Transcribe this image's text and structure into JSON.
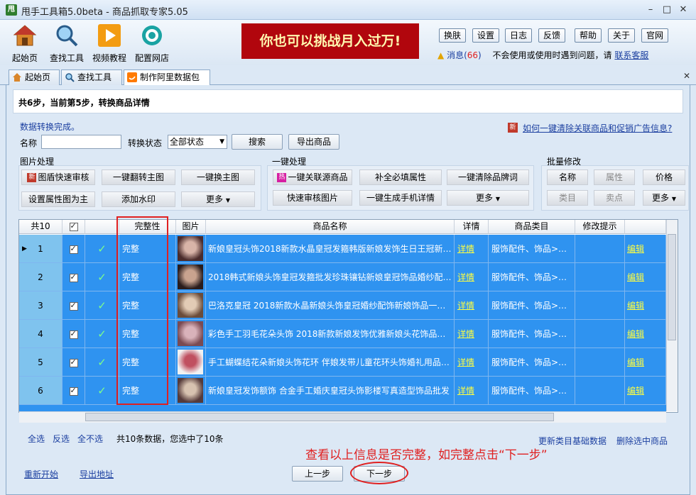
{
  "window": {
    "title": "甩手工具箱5.0beta - 商品抓取专家5.05",
    "icon_text": "甩"
  },
  "toolbar": {
    "items": [
      {
        "label": "起始页",
        "icon": "home-icon"
      },
      {
        "label": "查找工具",
        "icon": "magnifier-icon"
      },
      {
        "label": "视频教程",
        "icon": "play-icon"
      },
      {
        "label": "配置网店",
        "icon": "gear-icon"
      }
    ],
    "banner": "你也可以挑战月入过万!",
    "buttons": [
      "换肤",
      "设置",
      "日志",
      "反馈",
      "帮助",
      "关于",
      "官网"
    ],
    "message_label": "消息(",
    "message_count": "66",
    "message_close": ")",
    "help_text": "不会使用或使用时遇到问题，请",
    "help_link": "联系客服"
  },
  "tabs": [
    {
      "label": "起始页",
      "icon": "home-icon"
    },
    {
      "label": "查找工具",
      "icon": "magnifier-icon"
    },
    {
      "label": "制作阿里数据包",
      "icon": "alibaba-icon",
      "active": true
    }
  ],
  "step": {
    "text": "共6步，当前第5步，转换商品详情"
  },
  "status": "数据转换完成。",
  "help_link": "如何一键清除关联商品和促销广告信息?",
  "filter": {
    "name_label": "名称",
    "name_value": "",
    "state_label": "转换状态",
    "state_value": "全部状态",
    "search_label": "搜索",
    "export_label": "导出商品"
  },
  "image_group": {
    "title": "图片处理",
    "buttons": [
      "图盾快速审核",
      "一键翻转主图",
      "一键换主图",
      "设置属性图为主",
      "添加水印",
      "更多"
    ],
    "badge": "新"
  },
  "onekey_group": {
    "title": "一键处理",
    "buttons": [
      "一键关联源商品",
      "补全必填属性",
      "一键清除品牌词",
      "快速审核图片",
      "一键生成手机详情",
      "更多"
    ],
    "badge": "热"
  },
  "batch_group": {
    "title": "批量修改",
    "buttons": [
      "名称",
      "属性",
      "价格",
      "类目",
      "卖点",
      "更多"
    ]
  },
  "grid": {
    "headers": [
      "共10",
      "",
      "",
      "完整性",
      "图片",
      "商品名称",
      "详情",
      "商品类目",
      "修改提示",
      ""
    ],
    "rows": [
      {
        "num": "1",
        "complete": "完整",
        "name": "新娘皇冠头饰2018新款水晶皇冠发箍韩版新娘发饰生日王冠新…",
        "detail": "详情",
        "category": "服饰配件、饰品>…",
        "edit": "编辑"
      },
      {
        "num": "2",
        "complete": "完整",
        "name": "2018韩式新娘头饰皇冠发箍批发珍珠镶钻新娘皇冠饰品婚纱配…",
        "detail": "详情",
        "category": "服饰配件、饰品>…",
        "edit": "编辑"
      },
      {
        "num": "3",
        "complete": "完整",
        "name": "巴洛克皇冠 2018新款水晶新娘头饰皇冠婚纱配饰新娘饰品一…",
        "detail": "详情",
        "category": "服饰配件、饰品>…",
        "edit": "编辑"
      },
      {
        "num": "4",
        "complete": "完整",
        "name": "彩色手工羽毛花朵头饰 2018新款新娘发饰优雅新娘头花饰品…",
        "detail": "详情",
        "category": "服饰配件、饰品>…",
        "edit": "编辑"
      },
      {
        "num": "5",
        "complete": "完整",
        "name": "手工蝴蝶结花朵新娘头饰花环 伴娘发带儿童花环头饰婚礼用品…",
        "detail": "详情",
        "category": "服饰配件、饰品>…",
        "edit": "编辑"
      },
      {
        "num": "6",
        "complete": "完整",
        "name": "新娘皇冠发饰额饰 合金手工婚庆皇冠头饰影楼写真造型饰品批发",
        "detail": "详情",
        "category": "服饰配件、饰品>…",
        "edit": "编辑"
      }
    ]
  },
  "bottom": {
    "select_all": "全选",
    "invert": "反选",
    "select_none": "全不选",
    "summary": "共10条数据，您选中了10条",
    "update_category": "更新类目基础数据",
    "delete_selected": "删除选中商品",
    "restart": "重新开始",
    "export_addr": "导出地址",
    "prev": "上一步",
    "next": "下一步"
  },
  "annotation": "查看以上信息是否完整，如完整点击“下一步”",
  "colors": {
    "row_selected": "#2f93f0",
    "row_number": "#7fc3ee",
    "banner": "#b1060d",
    "annotation": "#e02020"
  }
}
